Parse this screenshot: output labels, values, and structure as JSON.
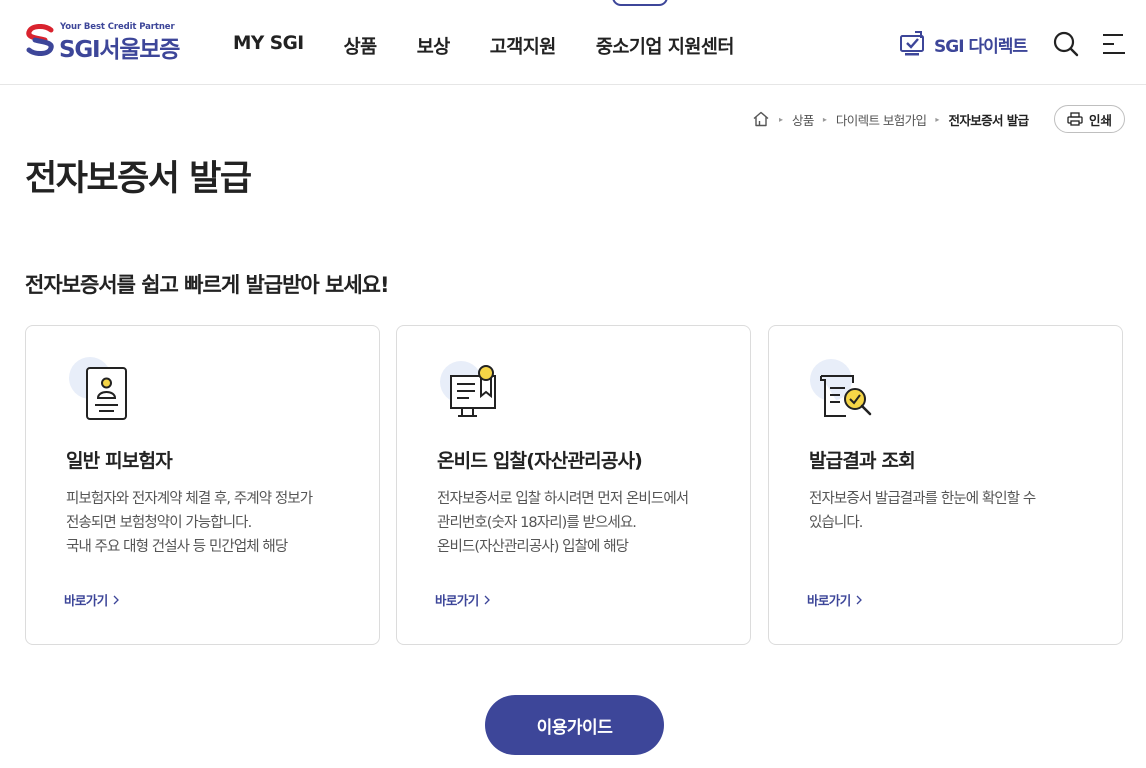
{
  "header": {
    "logo_tagline": "Your Best Credit Partner",
    "logo_text": "SGI서울보증",
    "nav": [
      "MY SGI",
      "상품",
      "보상",
      "고객지원",
      "중소기업 지원센터"
    ],
    "direct_label": "SGI 다이렉트",
    "icons": {
      "direct": "monitor-check-icon",
      "search": "search-icon",
      "menu": "hamburger-menu-icon"
    }
  },
  "breadcrumb": {
    "home_icon": "home-icon",
    "items": [
      "상품",
      "다이렉트 보험가입",
      "전자보증서 발급"
    ]
  },
  "print_label": "인쇄",
  "page_title": "전자보증서 발급",
  "intro": "전자보증서를 쉽고 빠르게 발급받아 보세요!",
  "cards": [
    {
      "icon": "id-card-person-icon",
      "title": "일반 피보험자",
      "desc": [
        "피보험자와 전자계약 체결 후, 주계약 정보가",
        "전송되면 보험청약이 가능합니다.",
        "국내 주요 대형 건설사 등 민간업체 해당"
      ],
      "link": "바로가기"
    },
    {
      "icon": "certificate-award-icon",
      "title": "온비드 입찰(자산관리공사)",
      "desc": [
        "전자보증서로 입찰 하시려면 먼저 온비드에서",
        "관리번호(숫자 18자리)를 받으세요.",
        "온비드(자산관리공사) 입찰에 해당"
      ],
      "link": "바로가기"
    },
    {
      "icon": "document-search-check-icon",
      "title": "발급결과 조회",
      "desc": [
        "전자보증서 발급결과를 한눈에 확인할 수",
        "있습니다."
      ],
      "link": "바로가기"
    }
  ],
  "guide_button": "이용가이드",
  "colors": {
    "brand": "#3d4699",
    "icon_bg": "#e8eef9",
    "accent_yellow": "#f5d547",
    "logo_red": "#d9232e"
  }
}
